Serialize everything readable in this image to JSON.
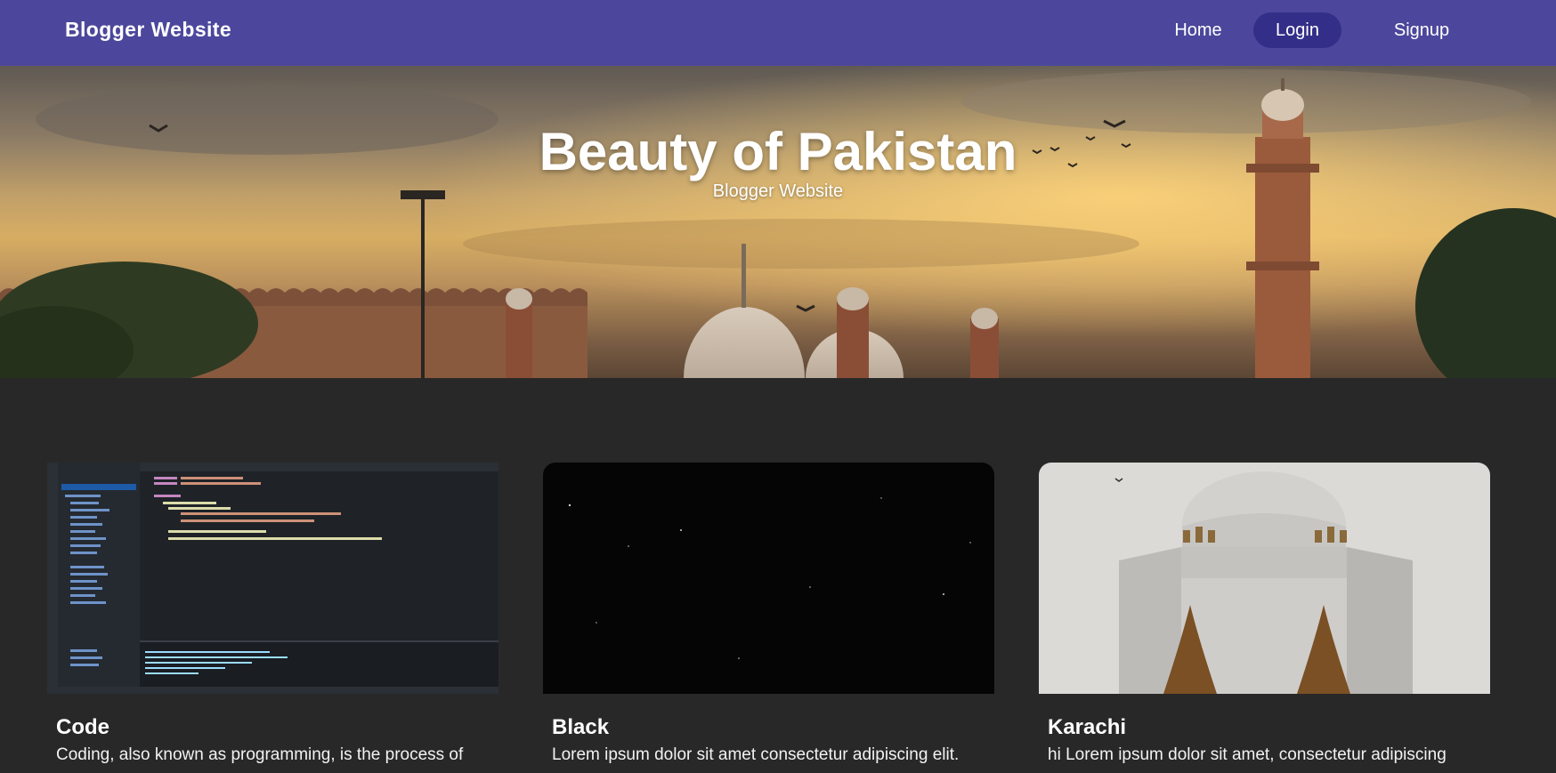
{
  "navbar": {
    "brand": "Blogger Website",
    "links": [
      {
        "label": "Home",
        "active": false
      },
      {
        "label": "Login",
        "active": true
      },
      {
        "label": "Signup",
        "active": false
      }
    ],
    "background": "#4c479c",
    "active_background": "#332e88"
  },
  "hero": {
    "title": "Beauty of Pakistan",
    "subtitle": "Blogger Website"
  },
  "cards": [
    {
      "title": "Code",
      "text": "Coding, also known as programming, is the process of",
      "image": "code-editor-screenshot"
    },
    {
      "title": "Black",
      "text": "Lorem ipsum dolor sit amet consectetur adipiscing elit.",
      "image": "black-night-sky"
    },
    {
      "title": "Karachi",
      "text": "hi Lorem ipsum dolor sit amet, consectetur adipiscing",
      "image": "karachi-mausoleum"
    }
  ],
  "colors": {
    "page_background": "#282828"
  }
}
